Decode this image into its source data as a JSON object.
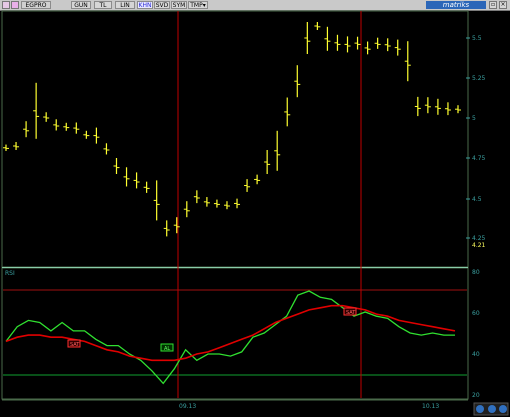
{
  "toolbar": {
    "symbol": "EGPRO",
    "buttons": [
      {
        "label": "GUN",
        "active": false
      },
      {
        "label": "TL",
        "active": false
      },
      {
        "label": "LIN",
        "active": false
      },
      {
        "label": "KHN",
        "active": true
      },
      {
        "label": "SVD",
        "active": false
      },
      {
        "label": "SYM",
        "active": false
      },
      {
        "label": "TMP",
        "active": false
      }
    ],
    "brand": "matriks",
    "icons": [
      "close-icon",
      "restore-icon"
    ]
  },
  "price_panel": {
    "y_ticks": [
      "5.5",
      "5.25",
      "5",
      "4.75",
      "4.5",
      "4.25"
    ],
    "last_value": "4.21"
  },
  "rsi_panel": {
    "title": "RSI",
    "y_ticks": [
      "60",
      "40"
    ],
    "top_tick": "80",
    "bottom_tick": "20",
    "markers": [
      {
        "label": "SAT",
        "color": "#ff3030"
      },
      {
        "label": "AL",
        "color": "#30e030"
      },
      {
        "label": "SAT",
        "color": "#ff3030"
      }
    ]
  },
  "x_axis": {
    "labels": [
      "09.13",
      "10.13"
    ]
  },
  "colors": {
    "background": "#000000",
    "price": "#ffff30",
    "rsi": "#30e030",
    "ma": "#e00000",
    "cursor": "#c00000",
    "axis_text": "#3aa0a0",
    "border": "#6a8a6a"
  },
  "chart_data": [
    {
      "type": "bar",
      "note_series": "OHLC price bars",
      "values": [
        4.81,
        4.82,
        4.92,
        5.01,
        5.0,
        4.95,
        4.94,
        4.93,
        4.89,
        4.88,
        4.8,
        4.69,
        4.62,
        4.6,
        4.56,
        4.46,
        4.3,
        4.32,
        4.42,
        4.5,
        4.47,
        4.46,
        4.45,
        4.46,
        4.57,
        4.61,
        4.71,
        4.77,
        5.02,
        5.21,
        5.48,
        5.57,
        5.48,
        5.46,
        5.45,
        5.46,
        5.43,
        5.46,
        5.45,
        5.43,
        5.33,
        5.06,
        5.07,
        5.06,
        5.05,
        5.05
      ],
      "ylim": [
        4.1,
        5.65
      ]
    },
    {
      "type": "line",
      "series": [
        {
          "name": "RSI",
          "values": [
            46,
            53,
            56,
            55,
            51,
            55,
            51,
            51,
            47,
            44,
            44,
            40,
            37,
            32,
            26,
            33,
            42,
            37,
            40,
            40,
            39,
            41,
            48,
            50,
            54,
            58,
            68,
            70,
            67,
            66,
            62,
            58,
            60,
            58,
            57,
            53,
            50,
            49,
            50,
            49,
            49
          ]
        },
        {
          "name": "",
          "values": [
            46,
            48,
            49,
            49,
            48,
            48,
            47,
            46,
            44,
            42,
            41,
            39,
            38,
            37,
            37,
            37,
            38,
            40,
            41,
            43,
            45,
            47,
            49,
            52,
            55,
            57,
            59,
            61,
            62,
            63,
            63,
            62,
            61,
            59,
            58,
            56,
            55,
            54,
            53,
            52,
            51
          ]
        }
      ],
      "ylim": [
        20,
        80
      ]
    }
  ]
}
